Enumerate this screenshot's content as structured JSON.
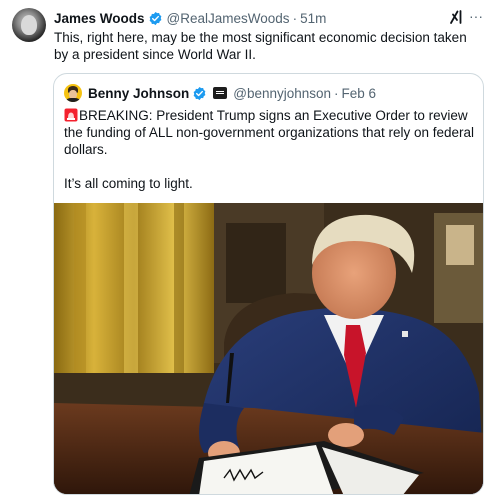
{
  "post": {
    "author_name": "James Woods",
    "author_handle": "@RealJamesWoods",
    "separator": "·",
    "time": "51m",
    "text": "This, right here, may be the most significant economic decision taken by a president since World War II."
  },
  "quoted_post": {
    "author_name": "Benny Johnson",
    "author_handle": "@bennyjohnson",
    "separator": "·",
    "time": "Feb 6",
    "text_line1": "BREAKING: President Trump signs an Executive Order to review the funding of ALL non-government organizations that rely on federal dollars.",
    "text_line2": "It’s all coming to light."
  },
  "icons": {
    "verified": "verified-badge-icon",
    "grok": "grok-icon",
    "more": "more-options-icon",
    "affiliation": "affiliation-badge-icon",
    "siren": "police-light-emoji"
  },
  "colors": {
    "verified": "#1d9bf0",
    "text": "#0f1419",
    "secondary": "#536471",
    "border": "#cfd9de"
  },
  "more_glyph": "···"
}
